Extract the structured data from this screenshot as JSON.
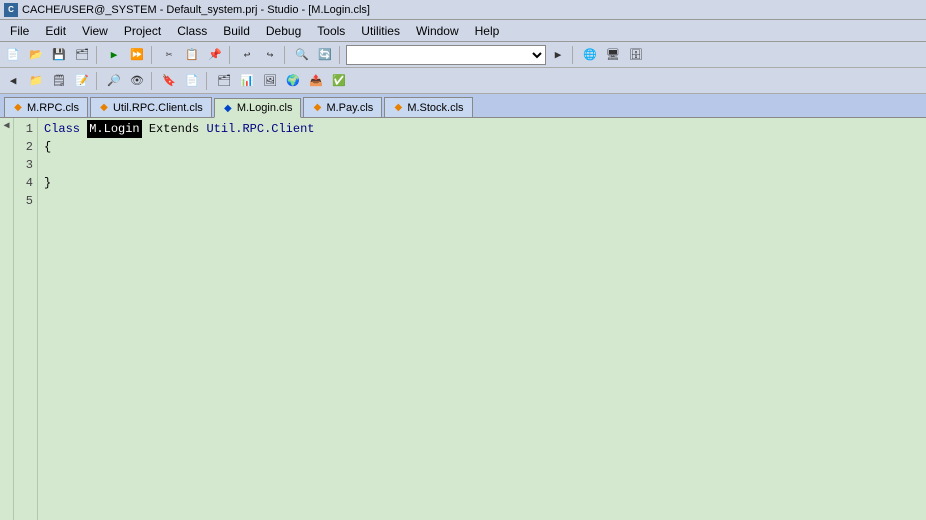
{
  "titlebar": {
    "text": "CACHE/USER@_SYSTEM - Default_system.prj - Studio - [M.Login.cls]",
    "icon": "C"
  },
  "menubar": {
    "items": [
      "File",
      "Edit",
      "View",
      "Project",
      "Class",
      "Build",
      "Debug",
      "Tools",
      "Utilities",
      "Window",
      "Help"
    ]
  },
  "tabs": [
    {
      "id": "mrpc",
      "label": "M.RPC.cls",
      "active": false,
      "icon_type": "orange"
    },
    {
      "id": "utilrpc",
      "label": "Util.RPC.Client.cls",
      "active": false,
      "icon_type": "orange"
    },
    {
      "id": "mlogin",
      "label": "M.Login.cls",
      "active": true,
      "icon_type": "blue"
    },
    {
      "id": "mpay",
      "label": "M.Pay.cls",
      "active": false,
      "icon_type": "orange"
    },
    {
      "id": "mstock",
      "label": "M.Stock.cls",
      "active": false,
      "icon_type": "orange"
    }
  ],
  "editor": {
    "lines": [
      {
        "num": 1,
        "content": "class_line"
      },
      {
        "num": 2,
        "content": "open_brace"
      },
      {
        "num": 3,
        "content": "empty"
      },
      {
        "num": 4,
        "content": "close_brace"
      },
      {
        "num": 5,
        "content": "empty"
      }
    ],
    "class_keyword": "Class",
    "class_name": "M.Login",
    "extends_keyword": "Extends",
    "parent_class": "Util.RPC.Client"
  },
  "toolbar": {
    "combo_placeholder": ""
  }
}
